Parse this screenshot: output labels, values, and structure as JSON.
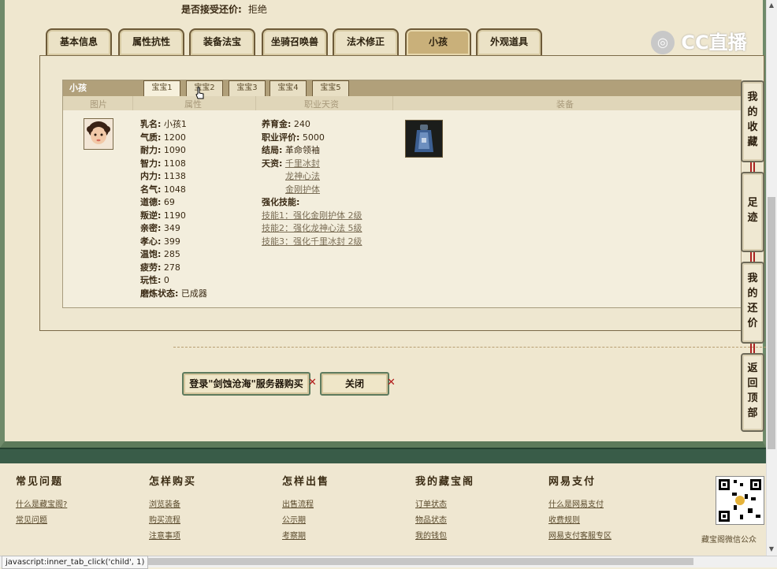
{
  "top": {
    "accept_label": "是否接受还价:",
    "accept_value": "拒绝"
  },
  "logo": {
    "text": "CC直播"
  },
  "main_tabs": [
    {
      "label": "基本信息"
    },
    {
      "label": "属性抗性"
    },
    {
      "label": "装备法宝"
    },
    {
      "label": "坐骑召唤兽"
    },
    {
      "label": "法术修正"
    },
    {
      "label": "小孩"
    },
    {
      "label": "外观道具"
    }
  ],
  "child_panel": {
    "title": "小孩",
    "baby_tabs": [
      {
        "label": "宝宝1"
      },
      {
        "label": "宝宝2"
      },
      {
        "label": "宝宝3"
      },
      {
        "label": "宝宝4"
      },
      {
        "label": "宝宝5"
      }
    ],
    "columns": {
      "image": "图片",
      "attrs": "属性",
      "career": "职业天资",
      "equip": "装备"
    },
    "attributes": [
      {
        "label": "乳名:",
        "value": "小孩1"
      },
      {
        "label": "气质:",
        "value": "1200"
      },
      {
        "label": "耐力:",
        "value": "1090"
      },
      {
        "label": "智力:",
        "value": "1108"
      },
      {
        "label": "内力:",
        "value": "1138"
      },
      {
        "label": "名气:",
        "value": "1048"
      },
      {
        "label": "道德:",
        "value": "69"
      },
      {
        "label": "叛逆:",
        "value": "1190"
      },
      {
        "label": "亲密:",
        "value": "349"
      },
      {
        "label": "孝心:",
        "value": "399"
      },
      {
        "label": "温饱:",
        "value": "285"
      },
      {
        "label": "疲劳:",
        "value": "278"
      },
      {
        "label": "玩性:",
        "value": "0"
      },
      {
        "label": "磨炼状态:",
        "value": "已成器"
      }
    ],
    "career": {
      "fund_label": "养育金:",
      "fund_value": "240",
      "rating_label": "职业评价:",
      "rating_value": "5000",
      "ending_label": "结局:",
      "ending_value": "革命领袖",
      "talent_label": "天资:",
      "talents": [
        "千里冰封",
        "龙神心法",
        "金刚护体"
      ],
      "skills_label": "强化技能:",
      "skills": [
        "技能1：强化金刚护体 2级",
        "技能2：强化龙神心法 5级",
        "技能3：强化千里冰封 2级"
      ]
    }
  },
  "actions": {
    "login_buy": "登录\"剑蚀沧海\"服务器购买",
    "close": "关闭"
  },
  "side_buttons": [
    {
      "label": "我的收藏"
    },
    {
      "label": "足迹"
    },
    {
      "label": "我的还价"
    },
    {
      "label": "返回顶部"
    }
  ],
  "footer": {
    "columns": [
      {
        "head": "常见问题",
        "links": [
          "什么是藏宝阁?",
          "常见问题"
        ]
      },
      {
        "head": "怎样购买",
        "links": [
          "浏览装备",
          "购买流程",
          "注意事项"
        ]
      },
      {
        "head": "怎样出售",
        "links": [
          "出售流程",
          "公示期",
          "考察期"
        ]
      },
      {
        "head": "我的藏宝阁",
        "links": [
          "订单状态",
          "物品状态",
          "我的钱包"
        ]
      },
      {
        "head": "网易支付",
        "links": [
          "什么是网易支付",
          "收费规则",
          "网易支付客服专区"
        ]
      }
    ],
    "qr_caption": "藏宝阁微信公众"
  },
  "status_bar": {
    "text": "javascript:inner_tab_click('child', 1)"
  }
}
